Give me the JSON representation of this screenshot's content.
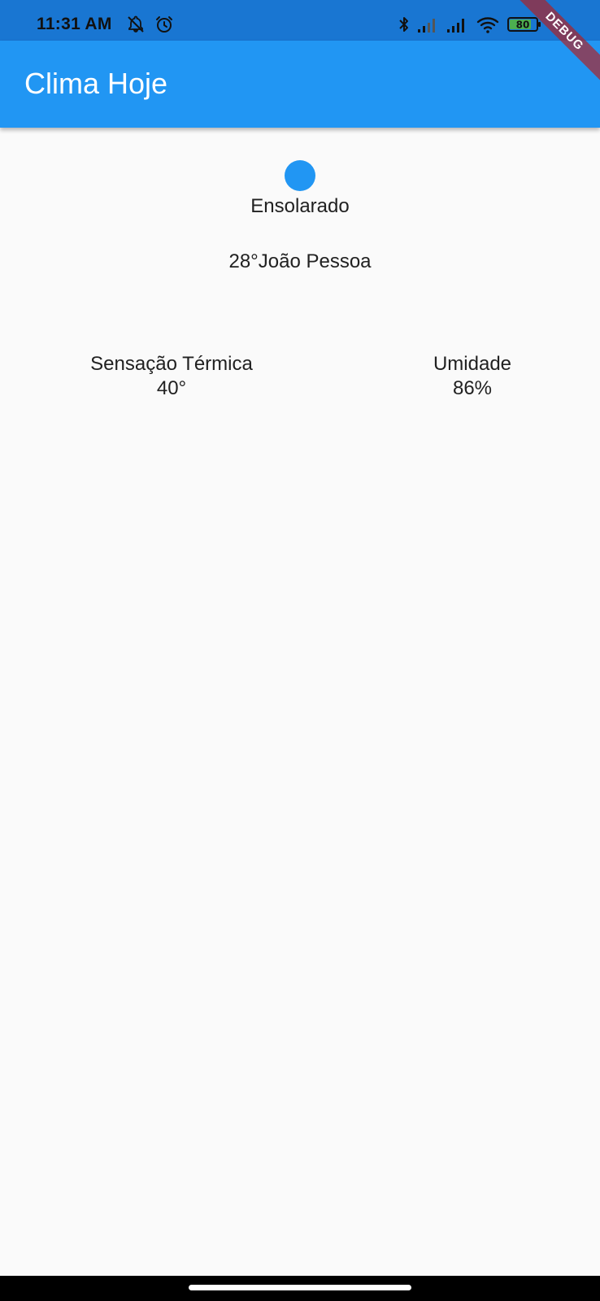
{
  "status_bar": {
    "time": "11:31 AM",
    "battery_level": "80",
    "left_icons": [
      "notifications-off-icon",
      "alarm-icon"
    ],
    "right_icons": [
      "bluetooth-icon",
      "signal-icon",
      "signal-icon",
      "wifi-icon",
      "battery-icon"
    ]
  },
  "app_bar": {
    "title": "Clima Hoje",
    "color": "#2196f3"
  },
  "debug_banner": {
    "label": "DEBUG"
  },
  "weather": {
    "icon": "weather-dot-icon",
    "condition": "Ensolarado",
    "temp_city": "28°João Pessoa",
    "feels_like": {
      "label": "Sensação Térmica",
      "value": "40°"
    },
    "humidity": {
      "label": "Umidade",
      "value": "86%"
    }
  }
}
